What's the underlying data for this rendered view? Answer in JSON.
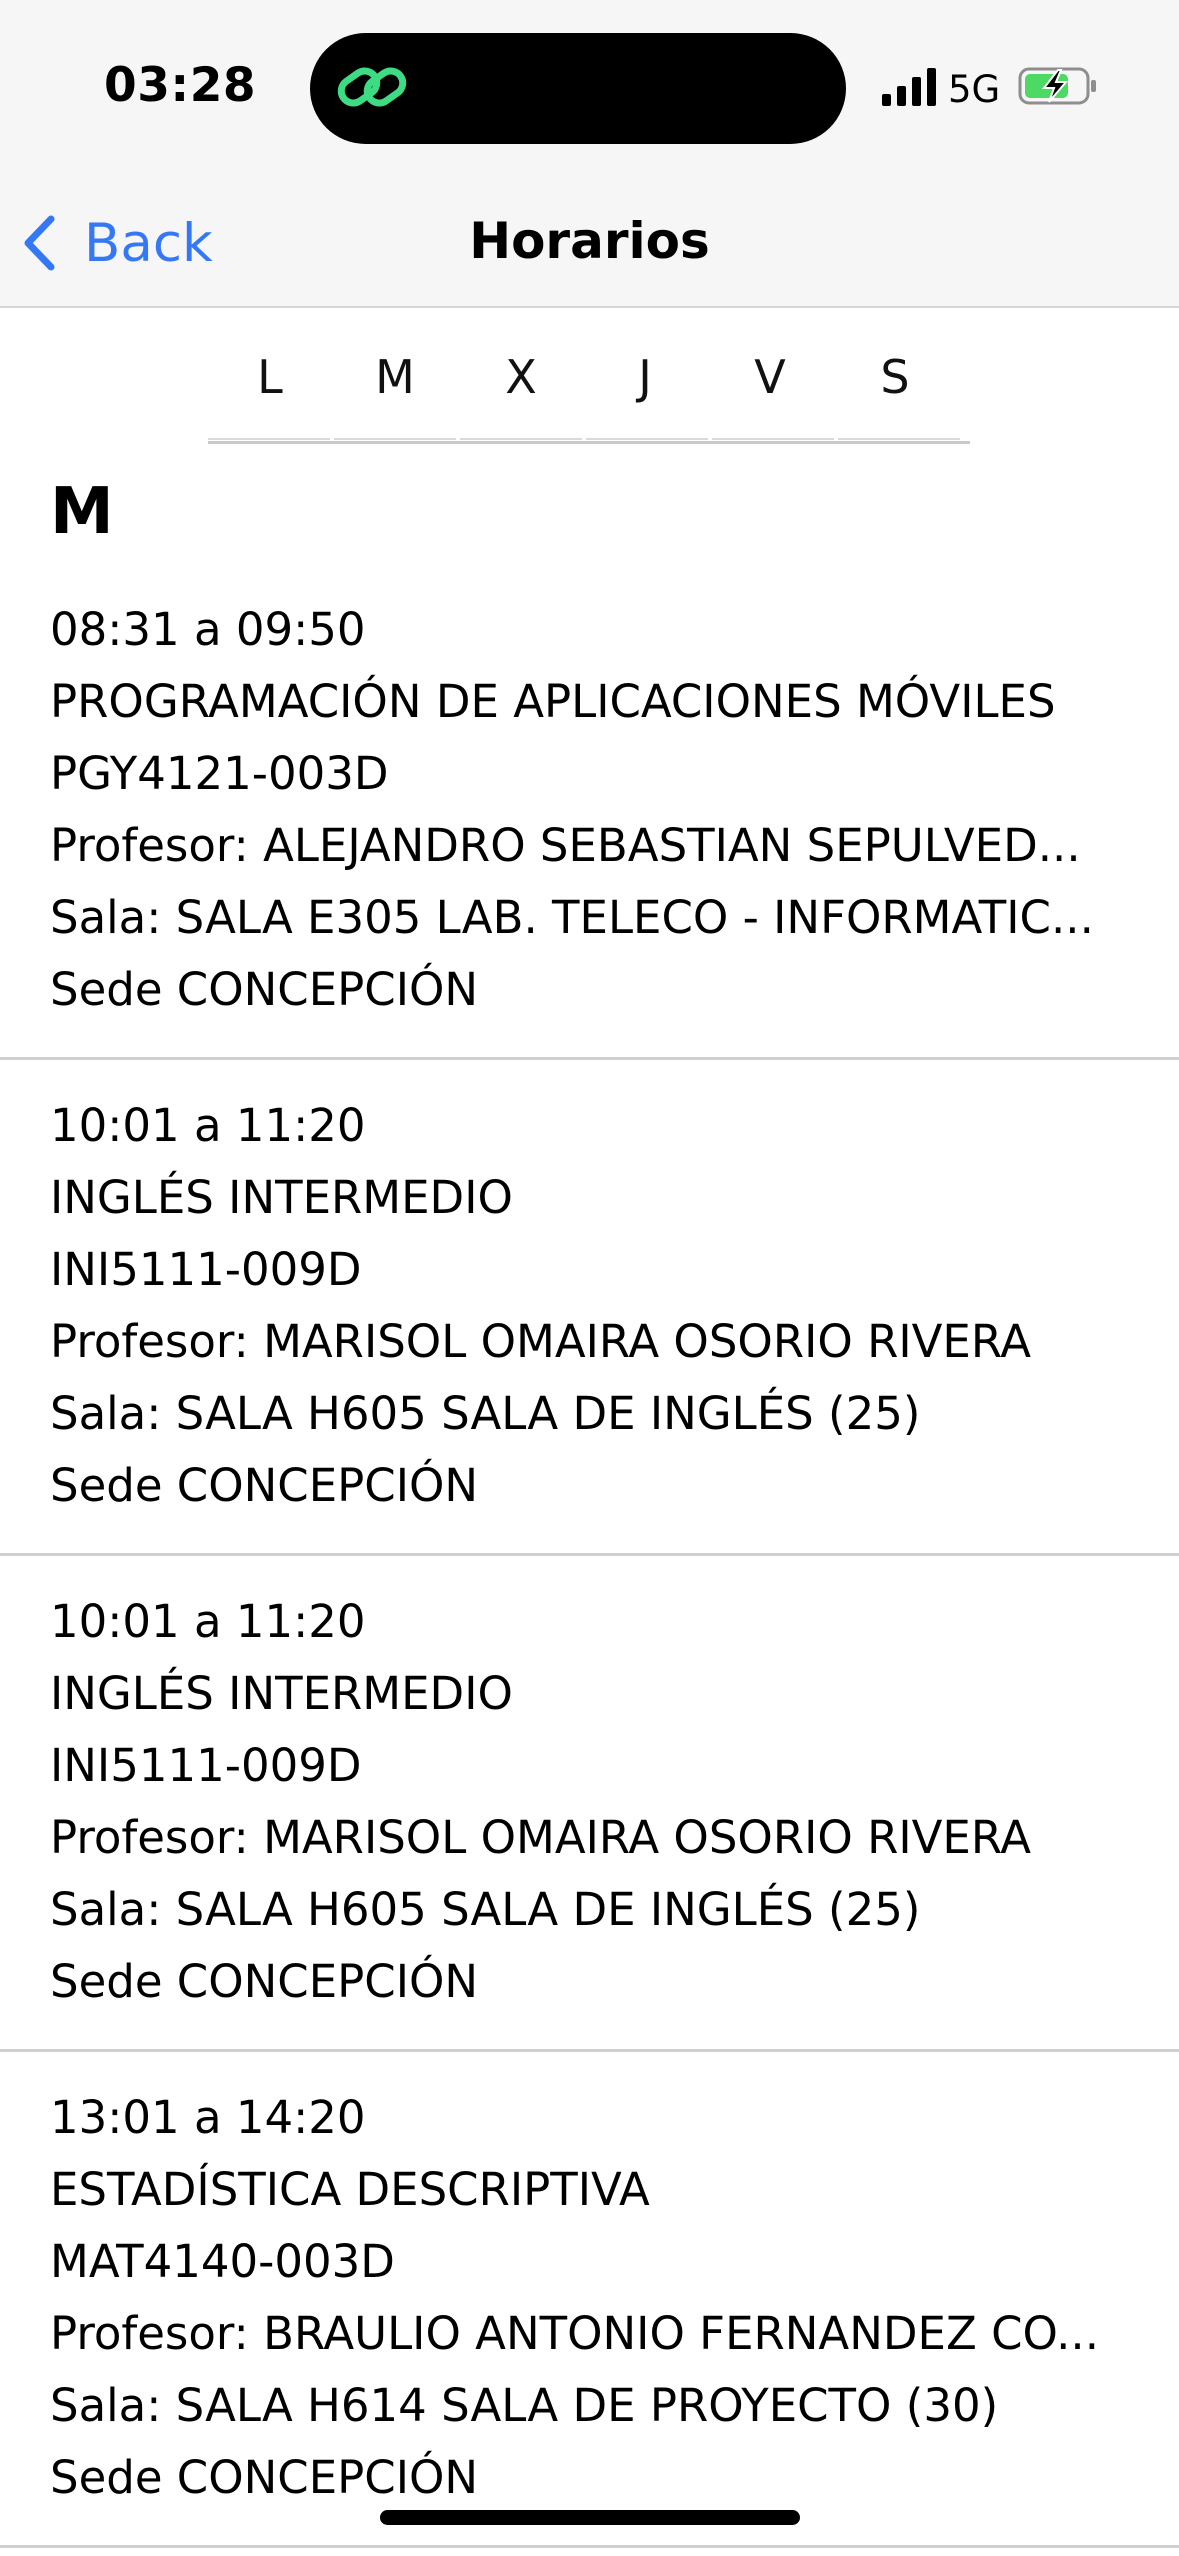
{
  "status_bar": {
    "time": "03:28",
    "network": "5G",
    "signal_icon": "cellular-signal-icon",
    "battery_icon": "battery-charging-icon",
    "island_icon": "link-icon",
    "colors": {
      "island_icon": "#3ddc84",
      "battery_fill": "#4cd964"
    }
  },
  "nav": {
    "back_label": "Back",
    "title": "Horarios",
    "colors": {
      "accent": "#3478f6"
    }
  },
  "days": [
    "L",
    "M",
    "X",
    "J",
    "V",
    "S"
  ],
  "selected_day": "M",
  "section": {
    "heading": "M"
  },
  "classes": [
    {
      "time": "08:31 a 09:50",
      "subject": "PROGRAMACIÓN DE APLICACIONES MÓVILES",
      "code": "PGY4121-003D",
      "teacher": "Profesor: ALEJANDRO SEBASTIAN SEPULVED...",
      "room": "Sala: SALA E305 LAB. TELECO - INFORMATIC...",
      "campus": "Sede CONCEPCIÓN"
    },
    {
      "time": "10:01 a 11:20",
      "subject": "INGLÉS INTERMEDIO",
      "code": "INI5111-009D",
      "teacher": "Profesor: MARISOL OMAIRA OSORIO RIVERA",
      "room": "Sala: SALA H605 SALA DE INGLÉS (25)",
      "campus": "Sede CONCEPCIÓN"
    },
    {
      "time": "10:01 a 11:20",
      "subject": "INGLÉS INTERMEDIO",
      "code": "INI5111-009D",
      "teacher": "Profesor: MARISOL OMAIRA OSORIO RIVERA",
      "room": "Sala: SALA H605 SALA DE INGLÉS (25)",
      "campus": "Sede CONCEPCIÓN"
    },
    {
      "time": "13:01 a 14:20",
      "subject": "ESTADÍSTICA DESCRIPTIVA",
      "code": "MAT4140-003D",
      "teacher": "Profesor: BRAULIO ANTONIO FERNANDEZ CO...",
      "room": "Sala: SALA H614 SALA DE PROYECTO (30)",
      "campus": "Sede CONCEPCIÓN"
    }
  ]
}
